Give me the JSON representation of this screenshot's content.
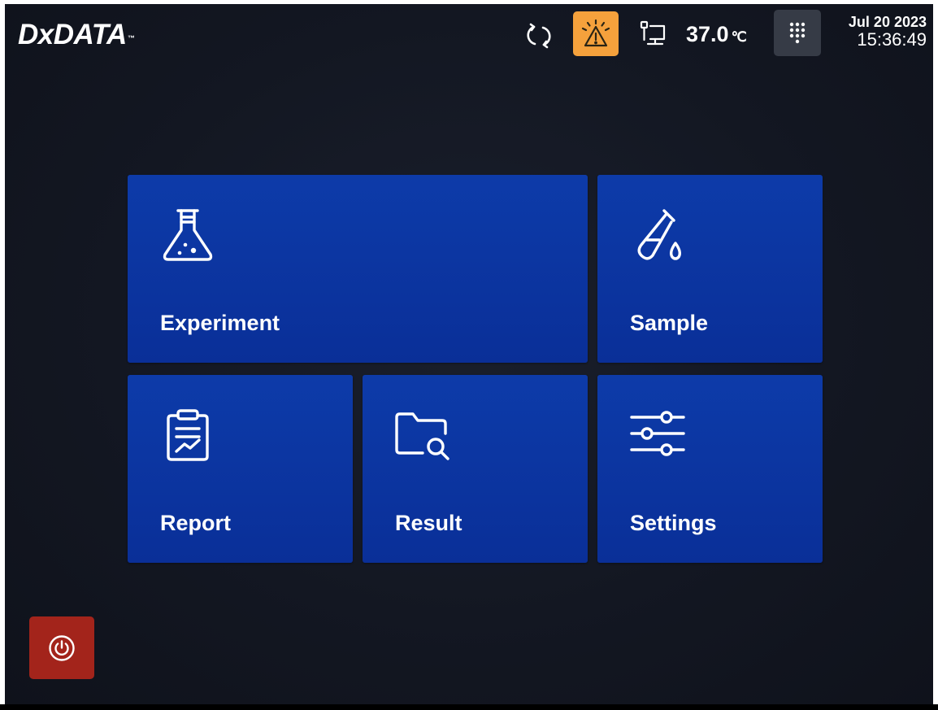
{
  "header": {
    "logo_text": "DxDATA",
    "logo_tm": "™",
    "temperature_value": "37.0",
    "temperature_unit": "℃",
    "date": "Jul 20 2023",
    "time": "15:36:49",
    "icons": {
      "sync": "sync-icon",
      "alert": "warning-icon",
      "network": "network-icon",
      "keypad": "keypad-icon"
    }
  },
  "tiles": [
    {
      "label": "Experiment",
      "icon": "flask-icon"
    },
    {
      "label": "Sample",
      "icon": "test-tube-icon"
    },
    {
      "label": "Report",
      "icon": "clipboard-chart-icon"
    },
    {
      "label": "Result",
      "icon": "folder-search-icon"
    },
    {
      "label": "Settings",
      "icon": "sliders-icon"
    }
  ],
  "footer": {
    "power_icon": "power-icon"
  },
  "colors": {
    "background": "#131722",
    "tile": "#0b34a0",
    "alert": "#f5a13c",
    "keypad": "#363b46",
    "power": "#a3241b"
  }
}
